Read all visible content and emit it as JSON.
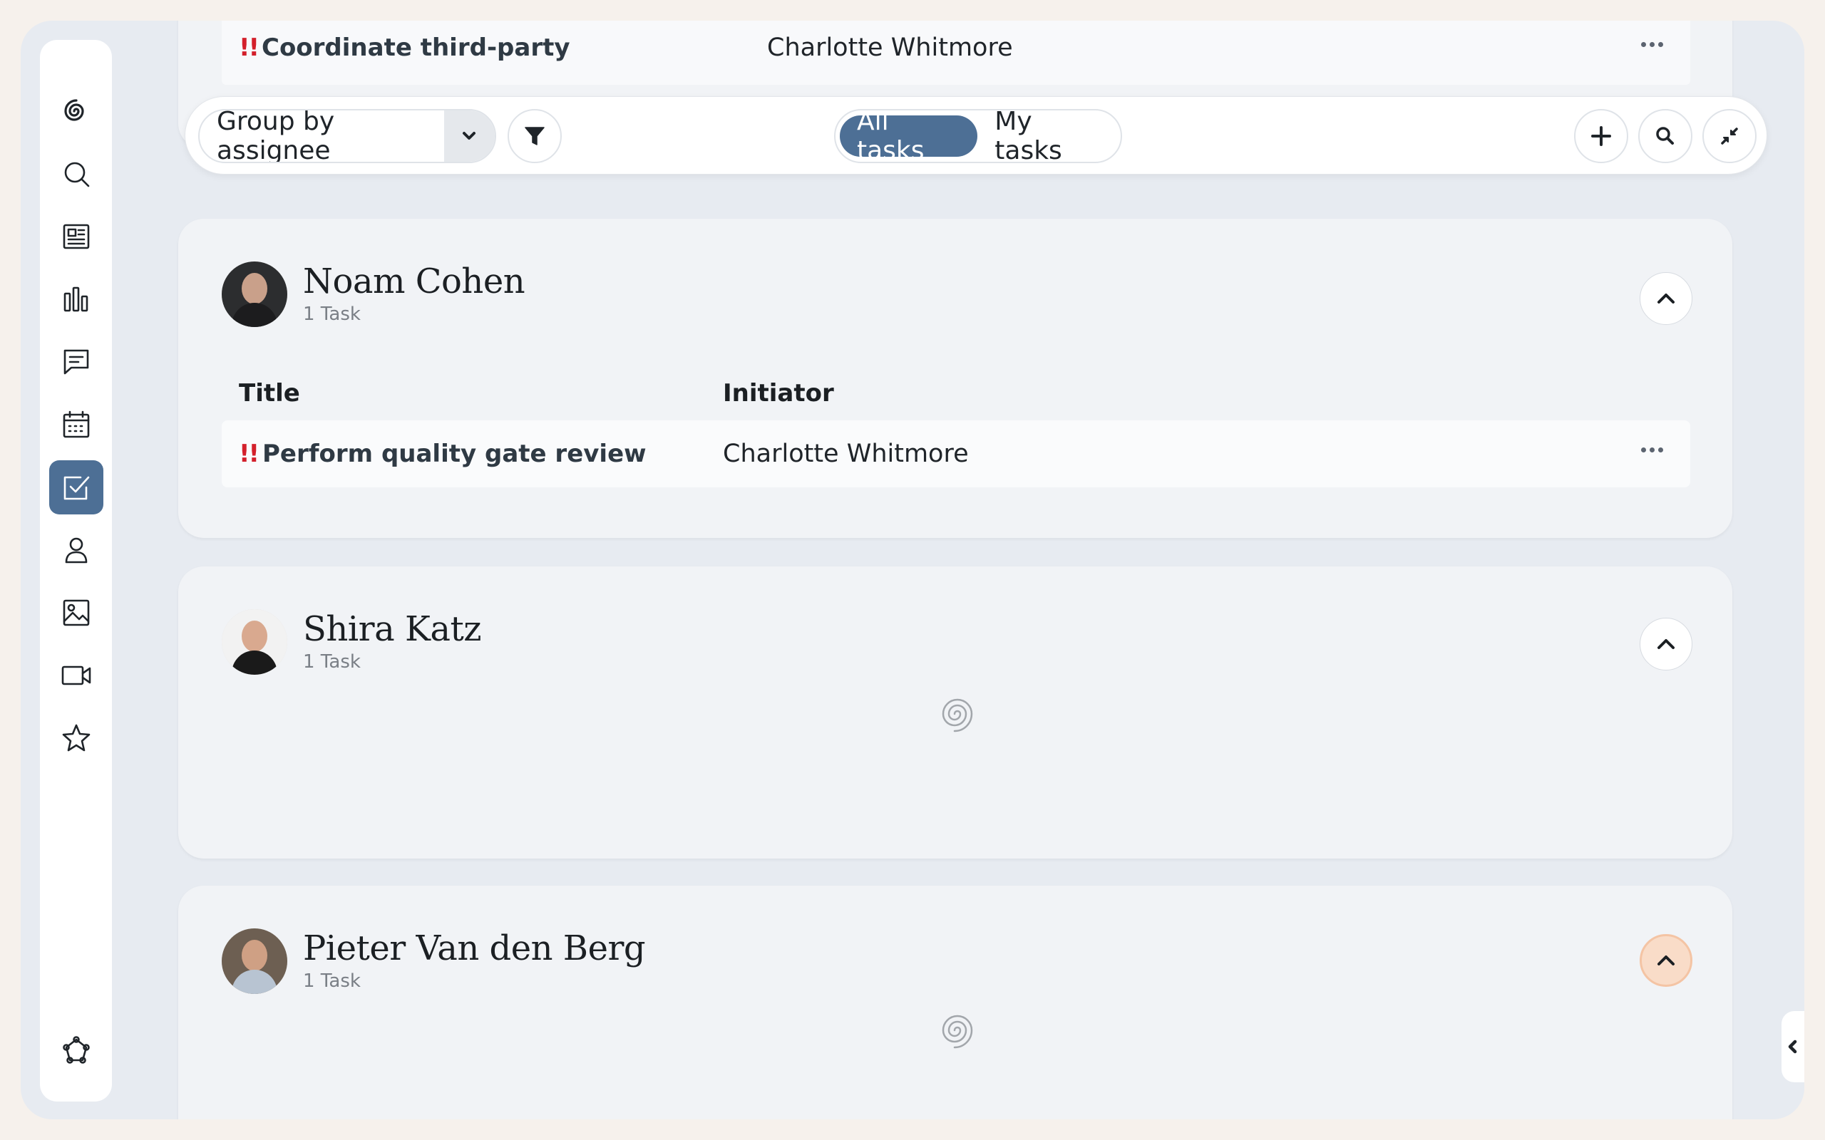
{
  "toolbar": {
    "group_by_label": "Group by assignee",
    "view_tabs": [
      "All tasks",
      "My tasks"
    ],
    "active_view": "All tasks"
  },
  "columns": {
    "title": "Title",
    "initiator": "Initiator"
  },
  "priority_marker": "!!",
  "partial_task": {
    "title": "Coordinate third-party",
    "initiator": "Charlotte Whitmore"
  },
  "groups": [
    {
      "assignee": "Noam Cohen",
      "count_label": "1 Task",
      "tasks": [
        {
          "title": "Perform quality gate review",
          "initiator": "Charlotte Whitmore"
        }
      ]
    },
    {
      "assignee": "Shira Katz",
      "count_label": "1 Task",
      "loading": true
    },
    {
      "assignee": "Pieter Van den Berg",
      "count_label": "1 Task",
      "loading": true
    }
  ],
  "sidebar": {
    "items": [
      "logo-icon",
      "search-icon",
      "news-icon",
      "analytics-icon",
      "messages-icon",
      "calendar-icon",
      "tasks-icon",
      "people-icon",
      "gallery-icon",
      "video-icon",
      "favorites-icon"
    ],
    "active": "tasks-icon",
    "bottom": "settings-icon"
  },
  "colors": {
    "accent": "#4d6f95",
    "priority": "#d3202b",
    "background": "#e7ebf1"
  }
}
